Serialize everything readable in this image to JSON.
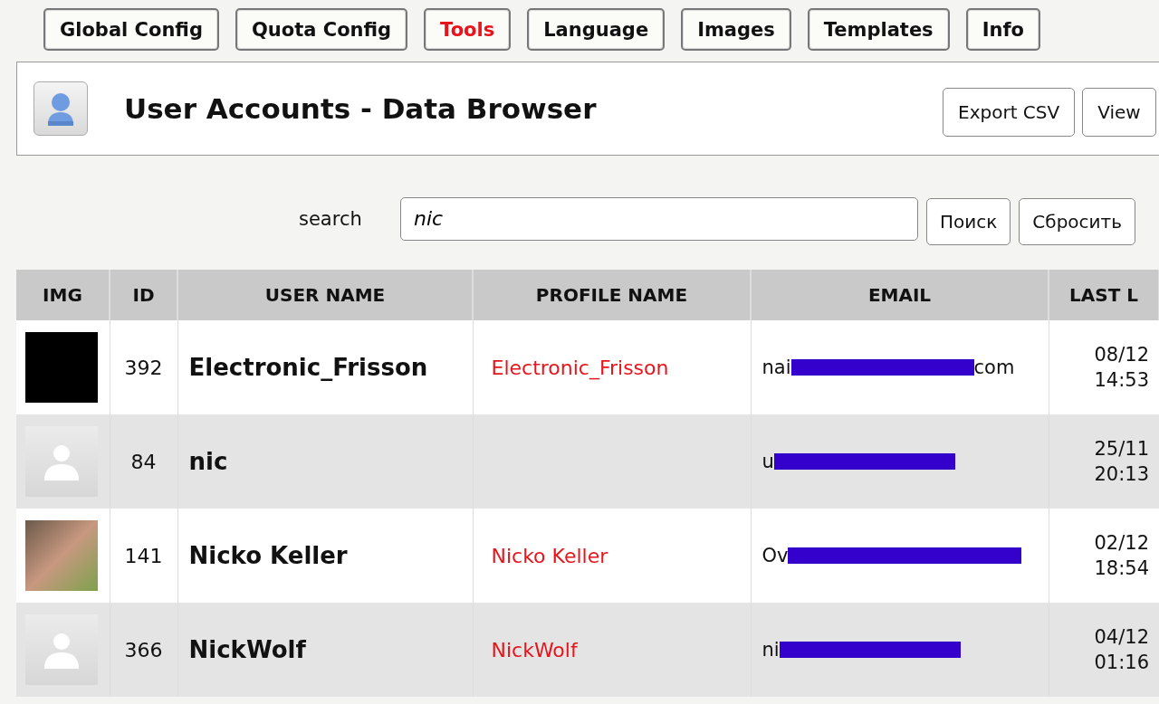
{
  "nav": [
    {
      "label": "Global Config",
      "selected": false
    },
    {
      "label": "Quota Config",
      "selected": false
    },
    {
      "label": "Tools",
      "selected": true
    },
    {
      "label": "Language",
      "selected": false
    },
    {
      "label": "Images",
      "selected": false
    },
    {
      "label": "Templates",
      "selected": false
    },
    {
      "label": "Info",
      "selected": false
    }
  ],
  "header": {
    "title": "User Accounts - Data Browser",
    "buttons": [
      "Export CSV",
      "View"
    ]
  },
  "search": {
    "label": "search",
    "value": "nic",
    "buttons": [
      "Поиск",
      "Сбросить"
    ]
  },
  "table": {
    "columns": [
      "IMG",
      "ID",
      "USER NAME",
      "PROFILE NAME",
      "EMAIL",
      "LAST L"
    ],
    "rows": [
      {
        "kind": "logo",
        "id": "392",
        "user_name": "Electronic_Frisson",
        "profile_name": "Electronic_Frisson",
        "email_start": "nai",
        "email_end": "com",
        "last_date": "08/12",
        "last_time": "14:53"
      },
      {
        "kind": "default",
        "id": "84",
        "user_name": "nic",
        "email_start": "u",
        "last_date": "25/11",
        "last_time": "20:13"
      },
      {
        "kind": "photo",
        "id": "141",
        "user_name": "Nicko Keller",
        "profile_name": "Nicko Keller",
        "email_start": "Ov",
        "last_date": "02/12",
        "last_time": "18:54"
      },
      {
        "kind": "default",
        "id": "366",
        "user_name": "NickWolf",
        "profile_name": "NickWolf",
        "email_start": "ni",
        "last_date": "04/12",
        "last_time": "01:16"
      }
    ]
  }
}
